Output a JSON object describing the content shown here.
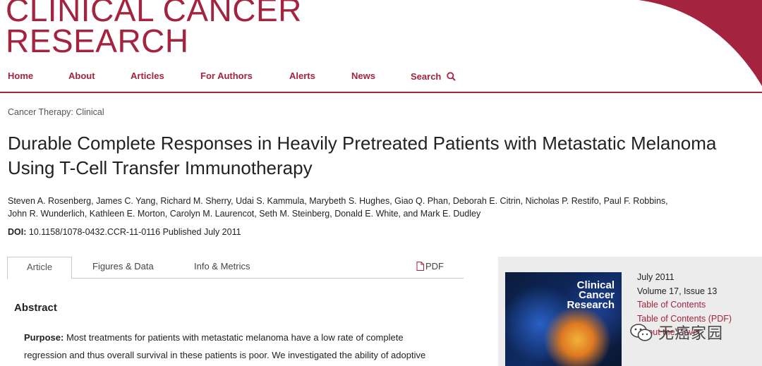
{
  "journal": {
    "name_line1": "CLINICAL CANCER",
    "name_line2": "RESEARCH",
    "brand_color": "#a4243f"
  },
  "nav": {
    "items": [
      {
        "label": "Home"
      },
      {
        "label": "About"
      },
      {
        "label": "Articles"
      },
      {
        "label": "For Authors"
      },
      {
        "label": "Alerts"
      },
      {
        "label": "News"
      },
      {
        "label": "Search",
        "icon": "search-icon"
      }
    ]
  },
  "article": {
    "category": "Cancer Therapy: Clinical",
    "title": "Durable Complete Responses in Heavily Pretreated Patients with Metastatic Melanoma Using T-Cell Transfer Immunotherapy",
    "authors_line1": "Steven A. Rosenberg, James C. Yang, Richard M. Sherry, Udai S. Kammula, Marybeth S. Hughes, Giao Q. Phan, Deborah E. Citrin, Nicholas P. Restifo, Paul F. Robbins,",
    "authors_line2": "John R. Wunderlich, Kathleen E. Morton, Carolyn M. Laurencot, Seth M. Steinberg, Donald E. White, and Mark E. Dudley",
    "doi_label": "DOI:",
    "doi_value": "10.1158/1078-0432.CCR-11-0116 Published July 2011"
  },
  "tabs": {
    "article": "Article",
    "figures": "Figures & Data",
    "info": "Info & Metrics",
    "pdf": "PDF",
    "active": "Article"
  },
  "abstract": {
    "heading": "Abstract",
    "purpose_label": "Purpose:",
    "purpose_line1": "Most treatments for patients with metastatic melanoma have a low rate of complete",
    "purpose_line2": "regression and thus overall survival in these patients is poor. We investigated the ability of adoptive"
  },
  "issue": {
    "cover_line1": "Clinical",
    "cover_line2": "Cancer",
    "cover_line3": "Research",
    "date": "July 2011",
    "volume": "Volume 17, Issue 13",
    "toc_link": "Table of Contents",
    "toc_pdf_link": "Table of Contents (PDF)",
    "about_cover_link": "About the Cover"
  },
  "watermark": {
    "text": "无癌家园",
    "icon": "wechat-icon"
  }
}
